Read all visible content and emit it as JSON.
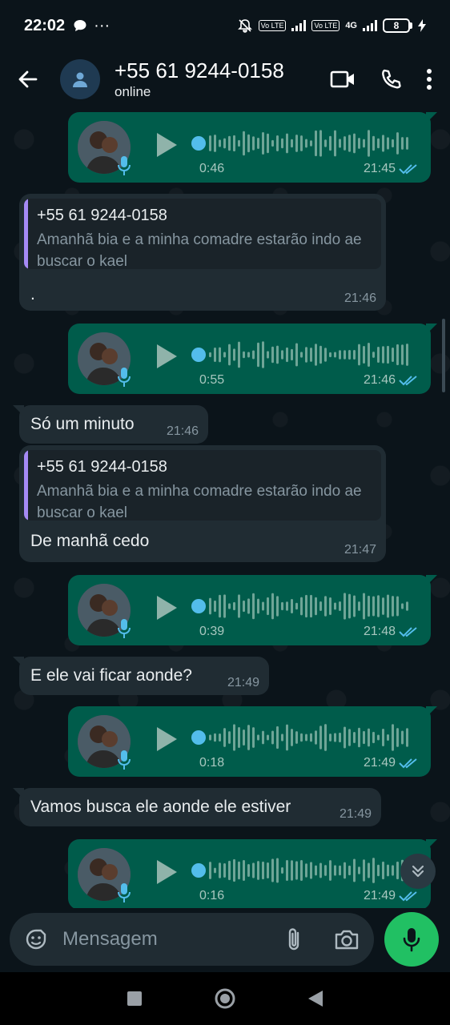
{
  "status_bar": {
    "time": "22:02",
    "more": "···",
    "volte_1": "Vo LTE",
    "volte_2": "Vo LTE",
    "network": "4G",
    "battery": "8"
  },
  "header": {
    "contact_name": "+55 61 9244-0158",
    "contact_status": "online"
  },
  "messages": [
    {
      "type": "voice",
      "direction": "out",
      "duration": "0:46",
      "time": "21:45",
      "read": true
    },
    {
      "type": "reply",
      "direction": "in",
      "quote_name": "+55 61 9244-0158",
      "quote_text": "Amanhã bia e a minha comadre estarão indo ae buscar o kael",
      "text": ".",
      "time": "21:46"
    },
    {
      "type": "voice",
      "direction": "out",
      "duration": "0:55",
      "time": "21:46",
      "read": true
    },
    {
      "type": "text",
      "direction": "in",
      "text": "Só um minuto",
      "time": "21:46"
    },
    {
      "type": "reply",
      "direction": "in",
      "quote_name": "+55 61 9244-0158",
      "quote_text": "Amanhã bia e a minha comadre estarão indo ae buscar o kael",
      "text": "De manhã cedo",
      "time": "21:47"
    },
    {
      "type": "voice",
      "direction": "out",
      "duration": "0:39",
      "time": "21:48",
      "read": true
    },
    {
      "type": "text",
      "direction": "in",
      "text": "E ele vai ficar aonde?",
      "time": "21:49"
    },
    {
      "type": "voice",
      "direction": "out",
      "duration": "0:18",
      "time": "21:49",
      "read": true
    },
    {
      "type": "text",
      "direction": "in",
      "text": "Vamos busca ele aonde ele estiver",
      "time": "21:49"
    },
    {
      "type": "voice",
      "direction": "out",
      "duration": "0:16",
      "time": "21:49",
      "read": true
    }
  ],
  "input": {
    "placeholder": "Mensagem"
  },
  "colors": {
    "background": "#0b141a",
    "outgoing_bubble": "#005c4b",
    "incoming_bubble": "#202c33",
    "accent_green": "#21c063",
    "read_check": "#53bdeb",
    "quote_bar": "#a58af5"
  },
  "icons": [
    "back-arrow-icon",
    "contact-avatar-icon",
    "video-call-icon",
    "phone-icon",
    "more-vert-icon",
    "play-icon",
    "mic-icon",
    "double-check-icon",
    "sticker-icon",
    "paperclip-icon",
    "camera-icon",
    "chevron-double-down-icon",
    "nav-square-icon",
    "nav-circle-icon",
    "nav-back-triangle-icon"
  ]
}
